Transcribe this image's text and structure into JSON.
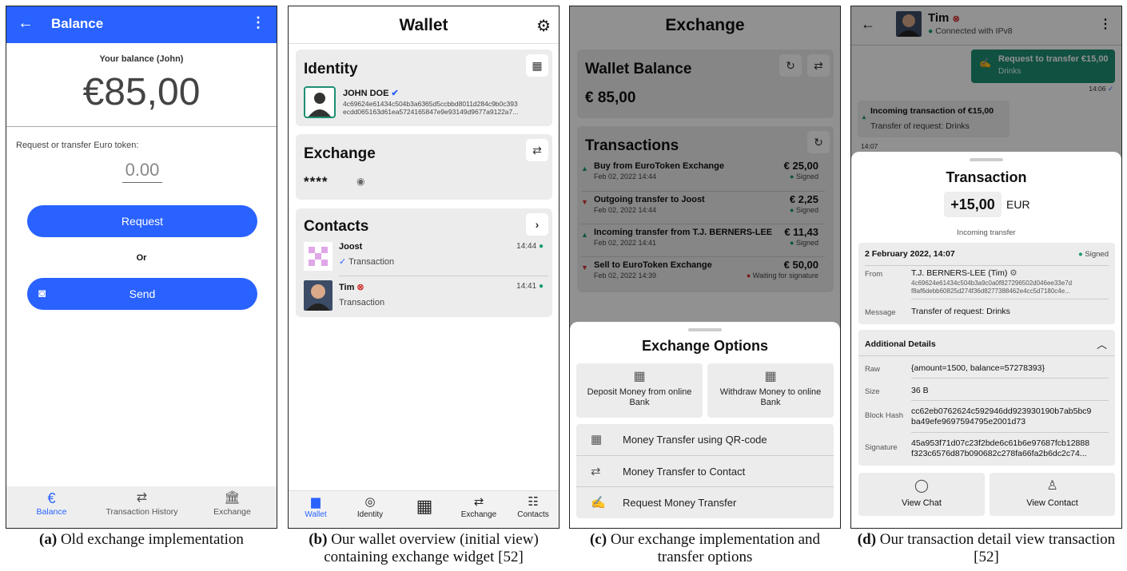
{
  "panel_a": {
    "title": "Balance",
    "balance_label": "Your balance (John)",
    "balance_amount": "€85,00",
    "request_label": "Request or transfer Euro token:",
    "amount_placeholder": "0.00",
    "request_button": "Request",
    "or_label": "Or",
    "send_button": "Send",
    "nav": [
      {
        "label": "Balance",
        "icon": "euro-icon"
      },
      {
        "label": "Transaction History",
        "icon": "history-icon"
      },
      {
        "label": "Exchange",
        "icon": "bank-icon"
      }
    ],
    "accent": "#2962ff"
  },
  "panel_b": {
    "title": "Wallet",
    "identity_heading": "Identity",
    "identity_name": "JOHN DOE",
    "identity_key": "4c69624e61434c504b3a6365d5ccbbd8011d284c9b0c393 ecdd065163d61ea5724165847e9e93149d9677a9122a7...",
    "exchange_heading": "Exchange",
    "exchange_balance_masked": "****",
    "contacts_heading": "Contacts",
    "contacts": [
      {
        "name": "Joost",
        "time": "14:44",
        "sub": "Transaction"
      },
      {
        "name": "Tim",
        "time": "14:41",
        "sub": "Transaction"
      }
    ],
    "nav": [
      {
        "label": "Wallet"
      },
      {
        "label": "Identity"
      },
      {
        "label": ""
      },
      {
        "label": "Exchange"
      },
      {
        "label": "Contacts"
      }
    ]
  },
  "panel_c": {
    "title": "Exchange",
    "wallet_balance_heading": "Wallet Balance",
    "wallet_balance": "€ 85,00",
    "transactions_heading": "Transactions",
    "transactions": [
      {
        "title": "Buy from EuroToken Exchange",
        "date": "Feb 02, 2022 14:44",
        "amount": "€ 25,00",
        "status": "Signed",
        "dir": "up"
      },
      {
        "title": "Outgoing transfer to Joost",
        "date": "Feb 02, 2022 14:44",
        "amount": "€ 2,25",
        "status": "Signed",
        "dir": "down"
      },
      {
        "title": "Incoming transfer from T.J. BERNERS-LEE",
        "date": "Feb 02, 2022 14:41",
        "amount": "€ 11,43",
        "status": "Signed",
        "dir": "up"
      },
      {
        "title": "Sell to EuroToken Exchange",
        "date": "Feb 02, 2022 14:39",
        "amount": "€ 50,00",
        "status": "Waiting for signature",
        "dir": "down"
      }
    ],
    "sheet_title": "Exchange Options",
    "deposit": "Deposit Money from online Bank",
    "withdraw": "Withdraw Money to online Bank",
    "options": [
      "Money Transfer using QR-code",
      "Money Transfer to Contact",
      "Request Money Transfer"
    ]
  },
  "panel_d": {
    "contact_name": "Tim",
    "contact_status": "Connected with IPv8",
    "sent_title": "Request to transfer €15,00",
    "sent_sub": "Drinks",
    "sent_time": "14:06",
    "recv_title": "Incoming transaction of €15,00",
    "recv_sub": "Transfer of request: Drinks",
    "recv_time": "14:07",
    "sheet_title": "Transaction",
    "amount": "+15,00",
    "currency": "EUR",
    "type": "Incoming transfer",
    "date": "2 February 2022, 14:07",
    "signed": "Signed",
    "from_label": "From",
    "from_name": "T.J. BERNERS-LEE (Tim)",
    "from_key": "4c69624e61434c504b3a9c0a0f827296502d046ee33e7d f8af6debb60825d274f36d8277388462e4cc5d7180c4e...",
    "message_label": "Message",
    "message": "Transfer of request: Drinks",
    "details_heading": "Additional Details",
    "raw_label": "Raw",
    "raw": "{amount=1500, balance=57278393}",
    "size_label": "Size",
    "size": "36 B",
    "hash_label": "Block Hash",
    "hash": "cc62eb0762624c592946dd923930190b7ab5bc9 ba49efe9697594795e2001d73",
    "sig_label": "Signature",
    "sig": "45a953f71d07c23f2bde6c61b6e97687fcb12888 f323c6576d87b090682c278fa66fa2b6dc2c74...",
    "view_chat": "View Chat",
    "view_contact": "View Contact"
  },
  "captions": [
    {
      "tag": "(a)",
      "text": "Old exchange implementation"
    },
    {
      "tag": "(b)",
      "text": "Our wallet overview (initial view) containing exchange widget [52]"
    },
    {
      "tag": "(c)",
      "text": "Our exchange implementation and transfer options"
    },
    {
      "tag": "(d)",
      "text": "Our transaction detail view transaction [52]"
    }
  ],
  "colors": {
    "green": "#1a9a6e",
    "red": "#d32f2f",
    "blue": "#2962ff",
    "teal": "#1f8f73"
  }
}
